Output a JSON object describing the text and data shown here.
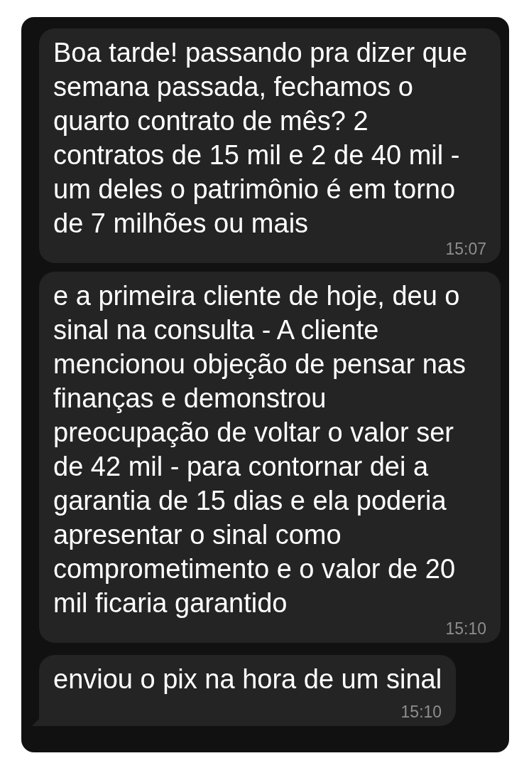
{
  "messages": [
    {
      "text": "Boa tarde! passando pra dizer que semana passada, fechamos o quarto contrato de mês? 2 contratos de 15 mil e 2 de 40 mil - um deles o patrimônio é em torno de 7 milhões ou mais",
      "time": "15:07",
      "tail": false
    },
    {
      "text": "e a primeira cliente de hoje, deu o sinal na consulta - A cliente mencionou objeção de pensar nas finanças e demonstrou preocupação de voltar o valor ser de 42 mil - para contornar dei a garantia de 15 dias e ela poderia apresentar o sinal como comprometimento e o valor de 20 mil ficaria garantido",
      "time": "15:10",
      "tail": false
    },
    {
      "text": "enviou o pix na hora de um sinal",
      "time": "15:10",
      "tail": true
    }
  ]
}
